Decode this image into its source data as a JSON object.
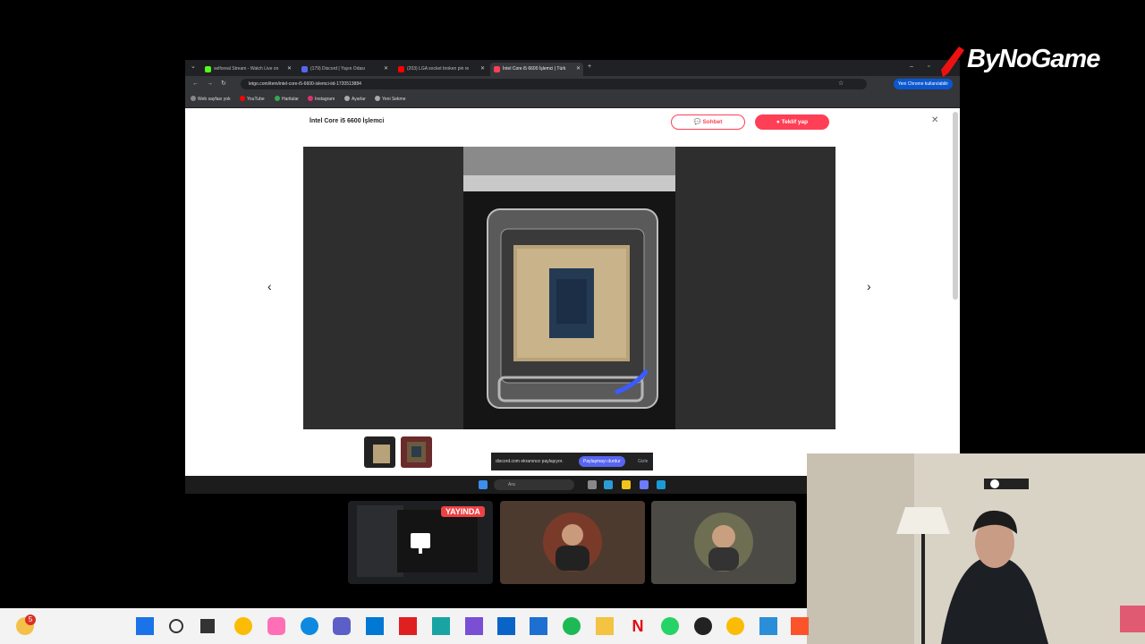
{
  "tabs": [
    {
      "label": "selforeal Stream - Watch Live on",
      "color": "#53fc18"
    },
    {
      "label": "(179) Discord | Yayın Odası",
      "color": "#5865f2"
    },
    {
      "label": "(203) LGA socket broken pin re",
      "color": "#ff0000"
    },
    {
      "label": "İntel Core i5 6600 İşlemci | Türk",
      "color": "#ff3f55"
    }
  ],
  "address": {
    "url": "letgo.com/item/intel-core-i5-6600-islemci-iid-1720513884",
    "chrome_button": "Yeni Chrome kullanılabilir"
  },
  "bookmarks": [
    "Web sayfası yok",
    "YouTube",
    "Haritalar",
    "Instagram",
    "Ayarlar",
    "Yeni Sekme"
  ],
  "listing": {
    "title": "İntel Core i5 6600 İşlemci",
    "chat_label": "Sohbet",
    "offer_label": "Teklif yap"
  },
  "share_bar": {
    "text": "discord.com ekranınızı paylaşıyor.",
    "stop": "Paylaşmayı durdur",
    "hide": "Gizle"
  },
  "inner_taskbar": {
    "search": "Ara"
  },
  "logo": {
    "text": "ByNoGame"
  },
  "discord": {
    "live_badge": "YAYINDA"
  },
  "taskbar": {
    "notification_count": "5"
  },
  "colors": {
    "accent": "#ff3f55",
    "discord": "#5865f2",
    "live": "#ed4245"
  }
}
